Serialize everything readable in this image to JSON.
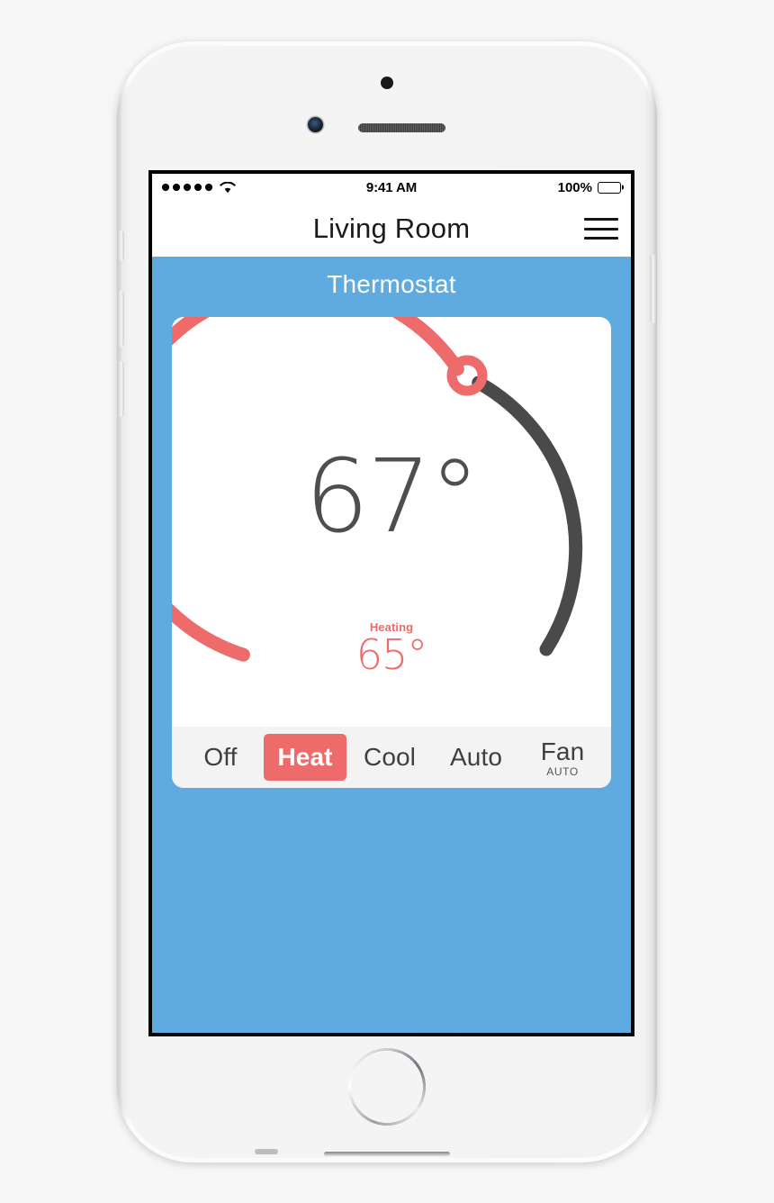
{
  "status_bar": {
    "signal_dots": 5,
    "wifi_icon": "wifi-icon",
    "time": "9:41 AM",
    "battery_percent": "100%",
    "battery_icon": "battery-full-icon"
  },
  "nav_bar": {
    "title": "Living Room",
    "menu_icon": "hamburger-menu-icon"
  },
  "section": {
    "title": "Thermostat"
  },
  "thermostat": {
    "current_temp": "67°",
    "setpoint_status": "Heating",
    "setpoint_temp": "65°",
    "handle_icon": "dial-handle-icon"
  },
  "modes": [
    {
      "label": "Off",
      "sub": "",
      "active": false
    },
    {
      "label": "Heat",
      "sub": "",
      "active": true
    },
    {
      "label": "Cool",
      "sub": "",
      "active": false
    },
    {
      "label": "Auto",
      "sub": "",
      "active": false
    },
    {
      "label": "Fan",
      "sub": "AUTO",
      "active": false
    }
  ],
  "colors": {
    "accent_blue": "#5faade",
    "accent_coral": "#ee6b6b",
    "track_dark": "#4a4a4a",
    "card_white": "#ffffff",
    "mode_bar_gray": "#f3f3f3",
    "temp_gray": "#4e4e4e"
  },
  "chart_data": {
    "type": "gauge",
    "title": "Thermostat dial",
    "current_value": 67,
    "setpoint_value": 65,
    "unit": "°F",
    "active_color": "#ee6b6b",
    "inactive_color": "#4a4a4a",
    "arc_start_deg": 215,
    "arc_handle_deg": 20,
    "arc_end_deg": 145,
    "status": "Heating"
  }
}
